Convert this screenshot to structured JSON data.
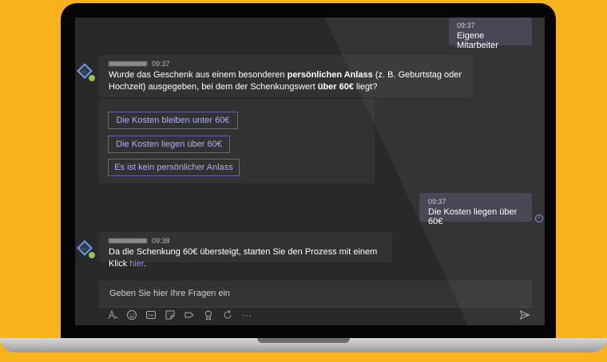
{
  "messages": {
    "out1": {
      "time": "09:37",
      "text": "Eigene Mitarbeiter"
    },
    "bot1": {
      "time": "09:37",
      "text_a": "Wurde das Geschenk aus einem besonderen ",
      "bold_a": "persönlichen Anlass",
      "text_b": " (z. B. Geburtstag oder Hochzeit) ausgegeben, bei dem der Schenkungswert ",
      "bold_b": "über 60€",
      "text_c": " liegt?"
    },
    "card": {
      "options": [
        "Die Kosten bleiben unter 60€",
        "Die Kosten liegen über 60€",
        "Es ist kein persönlicher Anlass"
      ]
    },
    "out2": {
      "time": "09:37",
      "text": "Die Kosten liegen über 60€"
    },
    "bot2": {
      "time": "09:38",
      "text": "Da die Schenkung 60€ übersteigt, starten Sie den Prozess mit einem Klick ",
      "link": "hier",
      "end": "."
    }
  },
  "compose": {
    "placeholder": "Geben Sie hier Ihre Fragen ein"
  },
  "toolbar": {
    "icons": [
      "format-icon",
      "emoji-icon",
      "gif-icon",
      "sticker-icon",
      "meet-icon",
      "praise-icon",
      "loop-icon",
      "more-icon"
    ],
    "more_label": "···"
  },
  "colors": {
    "accent": "#6264a7",
    "link": "#8b8cf0",
    "background": "#f8b21c"
  }
}
